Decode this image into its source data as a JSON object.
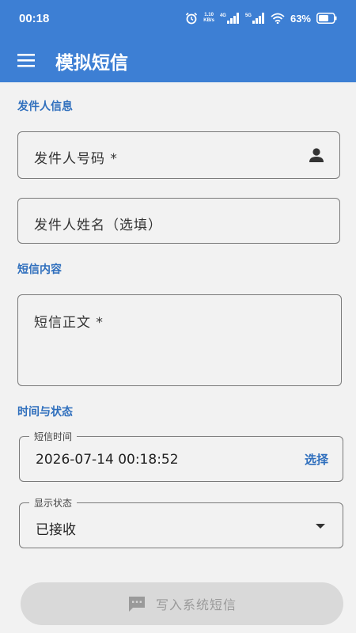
{
  "status_bar": {
    "time": "00:18",
    "net_speed_value": "1.10",
    "net_speed_unit": "KB/s",
    "signal1_label": "4G",
    "signal2_label": "5G",
    "battery_percent": "63%"
  },
  "app_bar": {
    "title": "模拟短信",
    "menu_icon": "hamburger-menu-icon"
  },
  "sections": {
    "sender_title": "发件人信息",
    "content_title": "短信内容",
    "time_status_title": "时间与状态"
  },
  "sender_number": {
    "placeholder": "发件人号码 *",
    "icon": "person-icon"
  },
  "sender_name": {
    "placeholder": "发件人姓名（选填）"
  },
  "message_body": {
    "placeholder": "短信正文 *"
  },
  "message_time": {
    "label": "短信时间",
    "value": "2026-07-14 00:18:52",
    "select_label": "选择"
  },
  "display_status": {
    "label": "显示状态",
    "value": "已接收"
  },
  "submit": {
    "label": "写入系统短信",
    "icon": "message-icon"
  },
  "colors": {
    "primary": "#3d7fd4",
    "accent_text": "#2f6fbd",
    "background": "#f2f2f2",
    "disabled_button": "#d9d9d9"
  }
}
